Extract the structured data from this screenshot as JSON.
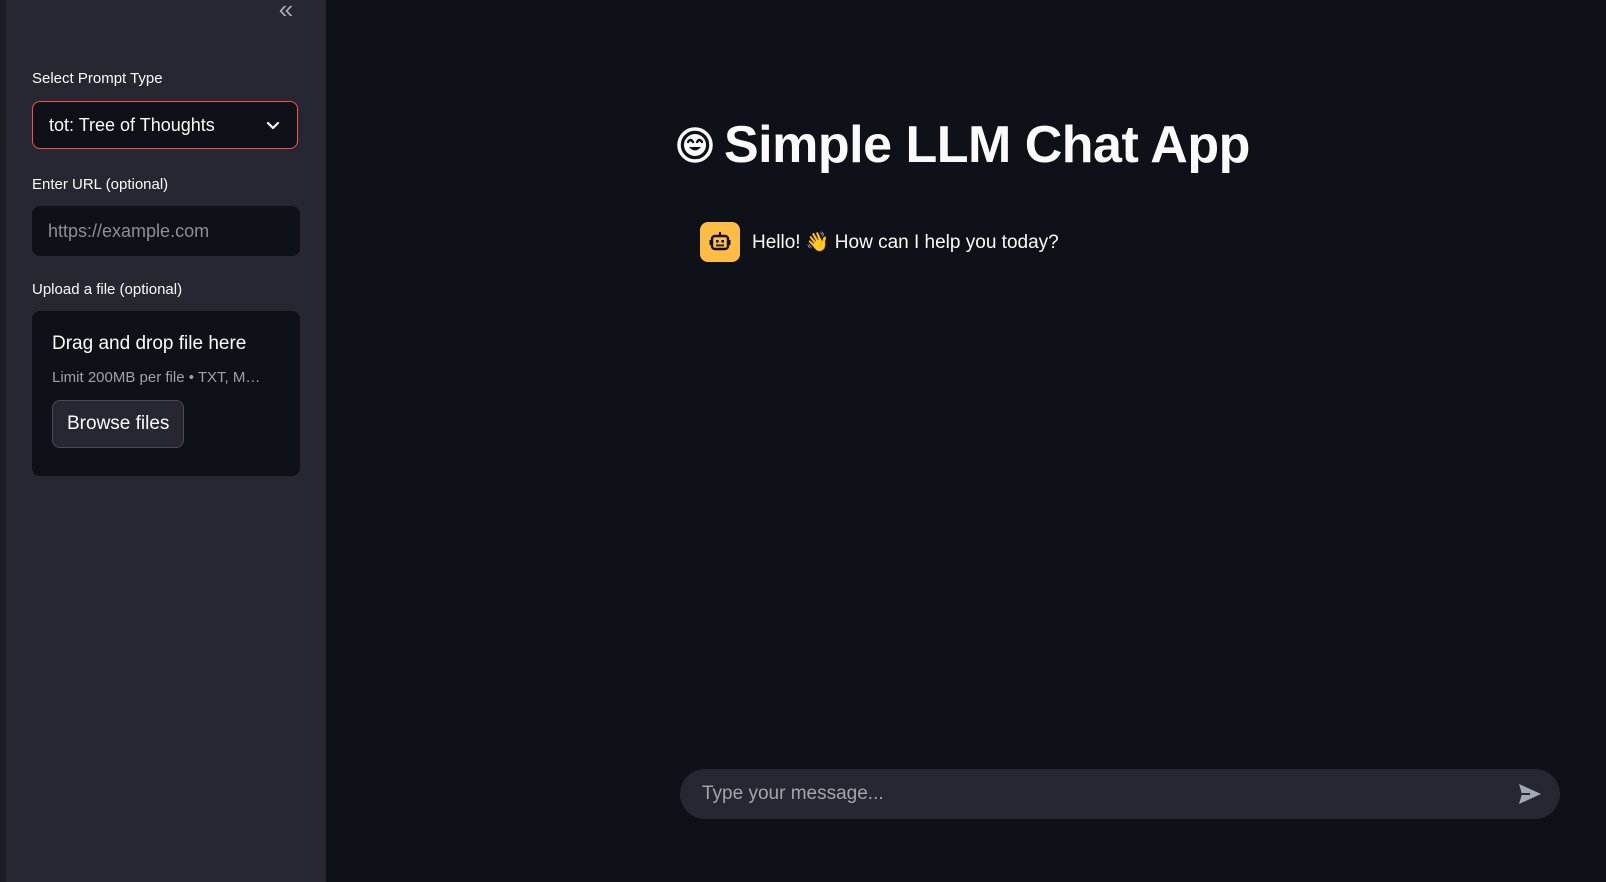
{
  "sidebar": {
    "collapse_icon": "double-chevron-left-icon",
    "collapse_glyph": "«",
    "prompt_type": {
      "label": "Select Prompt Type",
      "selected": "tot: Tree of Thoughts"
    },
    "url": {
      "label": "Enter URL (optional)",
      "placeholder": "https://example.com",
      "value": ""
    },
    "upload": {
      "label": "Upload a file (optional)",
      "drop_text": "Drag and drop file here",
      "limit_text": "Limit 200MB per file • TXT, M…",
      "browse_label": "Browse files"
    }
  },
  "main": {
    "title": "Simple LLM Chat App",
    "title_icon": "smiling-face-icon",
    "messages": [
      {
        "role": "assistant",
        "avatar_icon": "robot-icon",
        "text": "Hello! 👋 How can I help you today?"
      }
    ],
    "chat_input": {
      "placeholder": "Type your message...",
      "value": ""
    }
  },
  "colors": {
    "background": "#0e1117",
    "sidebar": "#262730",
    "accent_border": "#ff4b4b",
    "assistant_avatar": "#ffbd45"
  }
}
